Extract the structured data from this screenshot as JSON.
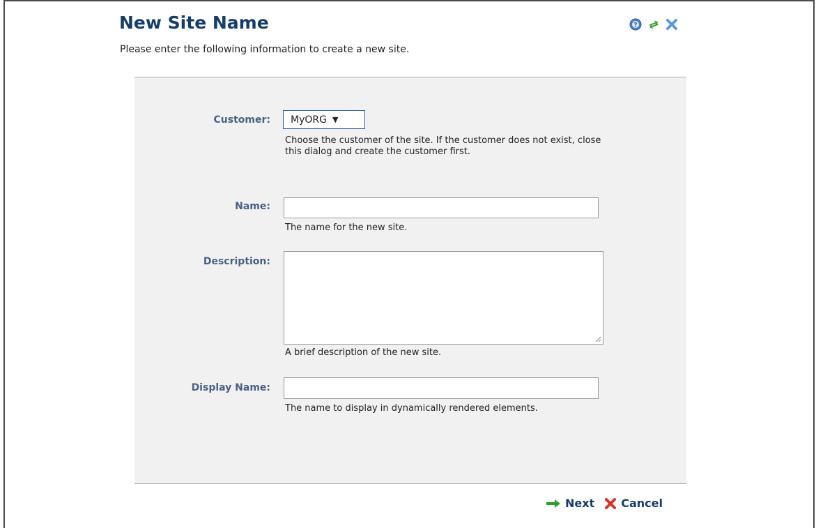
{
  "dialog": {
    "title": "New Site Name",
    "subtitle": "Please enter the following information to create a new site.",
    "toolbar": {
      "help_icon": "help-circle-icon",
      "refresh_icon": "refresh-icon",
      "close_icon": "close-icon"
    }
  },
  "form": {
    "customer": {
      "label": "Customer:",
      "value": "MyORG",
      "help": "Choose the customer of the site. If the customer does not exist, close this dialog and create the customer first."
    },
    "name": {
      "label": "Name:",
      "value": "",
      "help": "The name for the new site."
    },
    "description": {
      "label": "Description:",
      "value": "",
      "help": "A brief description of the new site."
    },
    "display_name": {
      "label": "Display Name:",
      "value": "",
      "help": "The name to display in dynamically rendered elements."
    }
  },
  "footer": {
    "next_label": "Next",
    "cancel_label": "Cancel",
    "next_icon": "arrow-right-icon",
    "cancel_icon": "x-icon"
  },
  "colors": {
    "title": "#163c6a",
    "label": "#4b6184",
    "panel_bg": "#f1f1f1",
    "accent_green": "#2e9e2e",
    "cancel_red": "#d8312a"
  }
}
